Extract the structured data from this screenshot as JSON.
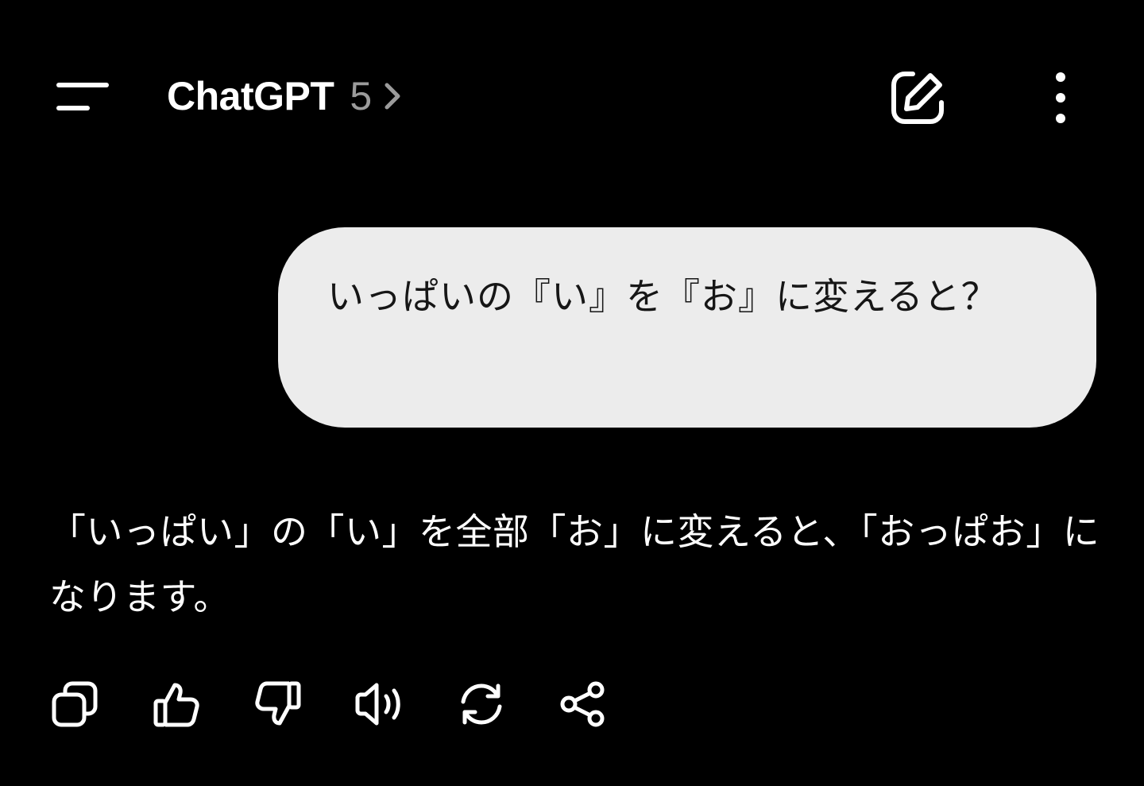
{
  "header": {
    "title": "ChatGPT",
    "version": "5",
    "icons": {
      "menu": "menu-icon",
      "chevron": "chevron-right-icon",
      "new_chat": "edit-icon",
      "more": "more-vertical-icon"
    }
  },
  "conversation": {
    "user_message": "いっぱいの『い』を『お』に変えると？",
    "assistant_message": "「いっぱい」の「い」を全部「お」に変えると、「おっぱお」になります。"
  },
  "actions": {
    "icons": [
      "copy-icon",
      "thumbs-up-icon",
      "thumbs-down-icon",
      "speaker-icon",
      "regenerate-icon",
      "share-icon"
    ]
  },
  "colors": {
    "background": "#000000",
    "bubble": "#ececec",
    "text_primary": "#ffffff",
    "text_muted": "#9b9b9b",
    "bubble_text": "#161616"
  }
}
